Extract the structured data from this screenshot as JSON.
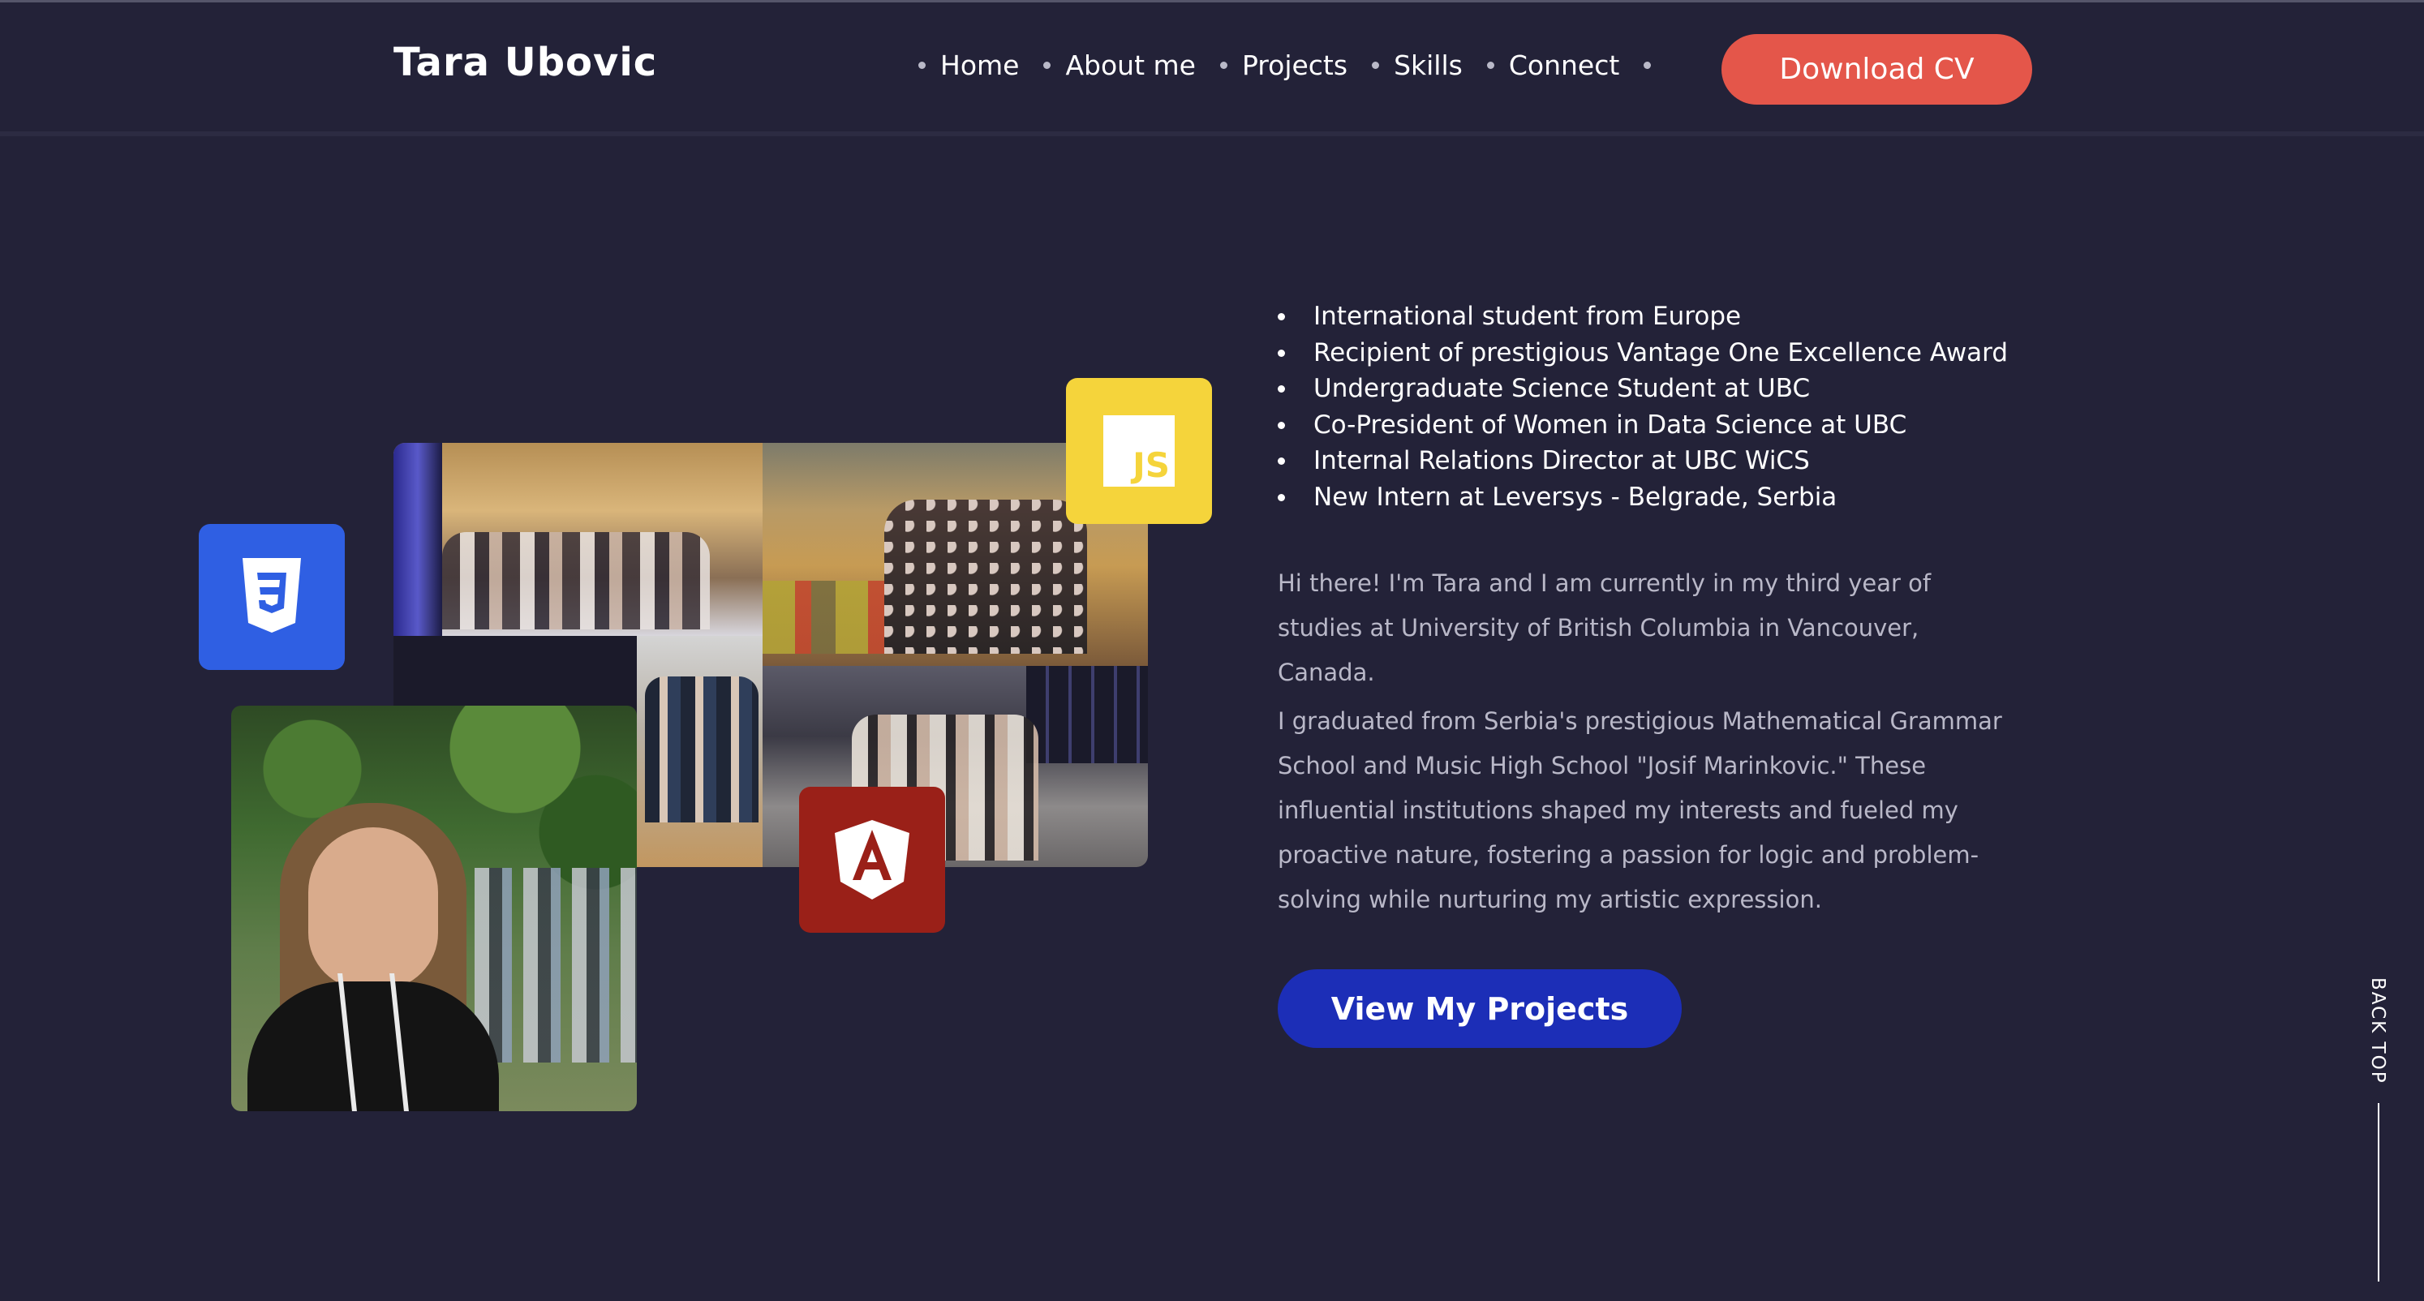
{
  "header": {
    "brand": "Tara Ubovic",
    "nav": [
      {
        "label": "Home"
      },
      {
        "label": "About me"
      },
      {
        "label": "Projects"
      },
      {
        "label": "Skills"
      },
      {
        "label": "Connect"
      }
    ],
    "cv_button": "Download CV"
  },
  "badges": {
    "js": "JS"
  },
  "about": {
    "facts": [
      "International student from Europe",
      "Recipient of prestigious Vantage One Excellence Award",
      "Undergraduate Science Student at UBC",
      "Co-President of Women in Data Science at UBC",
      "Internal Relations Director at UBC WiCS",
      "New Intern at Leversys - Belgrade, Serbia"
    ],
    "paragraph_1": "Hi there! I'm Tara and I am currently in my third year of studies at University of British Columbia in Vancouver, Canada.",
    "paragraph_2": "I graduated from Serbia's prestigious Mathematical Grammar School and Music High School \"Josif Marinkovic.\" These influential institutions shaped my interests and fueled my proactive nature, fostering a passion for logic and problem-solving while nurturing my artistic expression.",
    "projects_button": "View My Projects"
  },
  "back_top": {
    "label": "BACK TOP"
  },
  "colors": {
    "background": "#232238",
    "cv_button": "#e4564a",
    "projects_button": "#1c2eb7",
    "css_badge": "#2f5fe3",
    "js_badge": "#f5d43b",
    "angular_badge": "#9a2018"
  },
  "icons": [
    "css3-icon",
    "javascript-icon",
    "angular-icon"
  ]
}
